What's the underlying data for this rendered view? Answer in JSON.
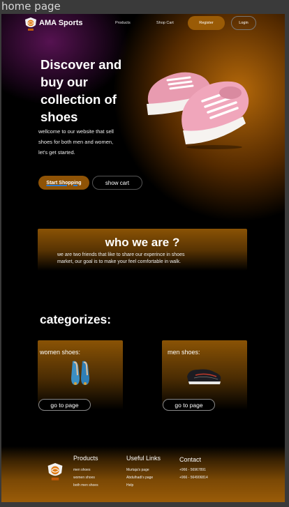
{
  "window": {
    "label": "home page"
  },
  "header": {
    "brand": "AMA Sports",
    "nav": [
      "Products",
      "Shop Cart"
    ],
    "register_label": "Register",
    "login_label": "Login"
  },
  "hero": {
    "title_lines": [
      "Discover and",
      "buy our",
      "collection of",
      "shoes"
    ],
    "text_lines": [
      "wellcome to our website that sell",
      "shoes for both men and women,",
      "let's get started."
    ],
    "start_label": "Start Shopping",
    "cart_label": "show cart"
  },
  "about": {
    "title": "who we are ?",
    "text_lines": [
      "we are two friends that like to share our experince in shoes",
      "market, our goal is to make your feel comfortable in walk."
    ]
  },
  "categories": {
    "title": "categorizes:",
    "items": [
      {
        "label": "women shoes:",
        "button": "go to page"
      },
      {
        "label": "men shoes:",
        "button": "go to page"
      }
    ]
  },
  "footer": {
    "products": {
      "title": "Products",
      "items": [
        "men shoes",
        "women shoes",
        "both men shoes"
      ]
    },
    "links": {
      "title": "Useful Links",
      "items": [
        "Murtaja's page",
        "Abdulhadi's page",
        "Help"
      ]
    },
    "contact": {
      "title": "Contact",
      "items": [
        "+966 - 56967891",
        "+966 - 564906814"
      ]
    }
  },
  "colors": {
    "accent": "#9a5b06",
    "background": "#000000",
    "purple_glow": "#5f145a"
  }
}
